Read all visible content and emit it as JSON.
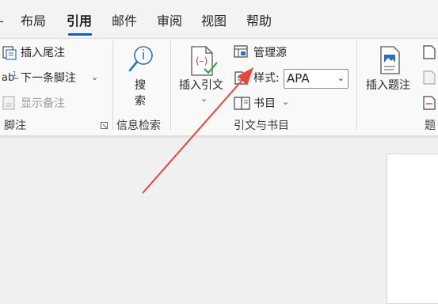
{
  "tabs": [
    {
      "label": "布局",
      "active": false
    },
    {
      "label": "引用",
      "active": true
    },
    {
      "label": "邮件",
      "active": false
    },
    {
      "label": "审阅",
      "active": false
    },
    {
      "label": "视图",
      "active": false
    },
    {
      "label": "帮助",
      "active": false
    }
  ],
  "footnotes": {
    "insert_endnote": "插入尾注",
    "next_footnote": "下一条脚注",
    "show_notes": "显示备注",
    "group_label": "脚注"
  },
  "research": {
    "search_line1": "搜",
    "search_line2": "索",
    "group_label": "信息检索"
  },
  "citations": {
    "insert_citation": "插入引文",
    "manage_sources": "管理源",
    "style_label": "样式:",
    "style_value": "APA",
    "bibliography": "书目",
    "group_label": "引文与书目"
  },
  "captions": {
    "insert_caption": "插入题注",
    "group_label_partial": "题"
  },
  "colors": {
    "accent": "#185abd",
    "arrow": "#e8453c"
  },
  "icons": [
    "insert-endnote-icon",
    "next-footnote-icon",
    "show-notes-icon",
    "dialog-launcher-icon",
    "search-icon",
    "insert-citation-icon",
    "manage-sources-icon",
    "style-icon",
    "bibliography-icon",
    "insert-caption-icon"
  ]
}
